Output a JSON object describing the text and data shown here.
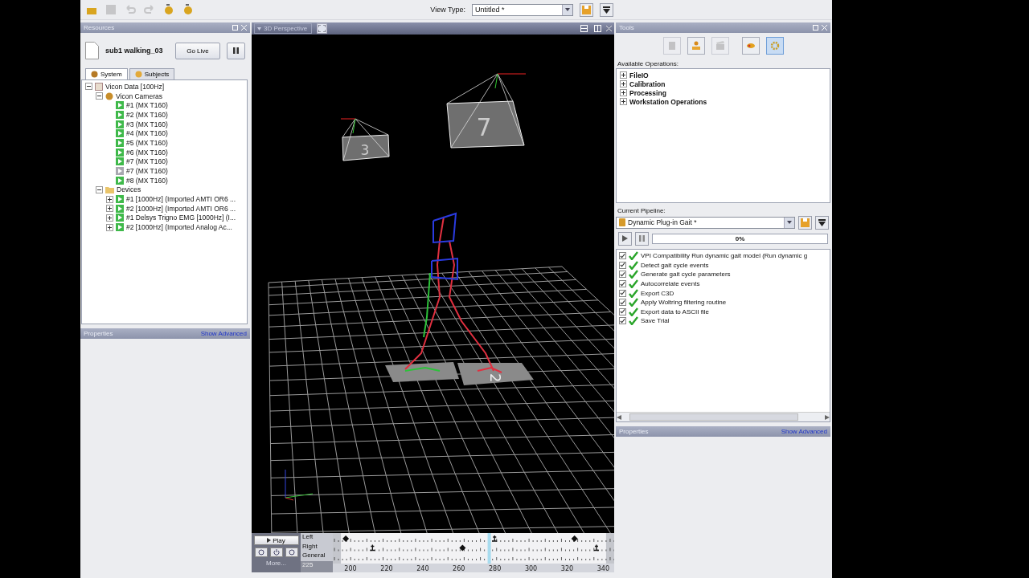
{
  "toolbar": [
    {
      "kind": "open",
      "disabled": false
    },
    {
      "kind": "save",
      "disabled": true
    },
    {
      "kind": "undo",
      "disabled": true
    },
    {
      "kind": "redo",
      "disabled": true
    },
    {
      "kind": "script",
      "disabled": false
    },
    {
      "kind": "script",
      "disabled": false
    }
  ],
  "view_type": {
    "label": "View Type:",
    "value": "Untitled *"
  },
  "resources": {
    "title": "Resources",
    "trial": "sub1 walking_03",
    "go_live": "Go Live",
    "tabs": [
      {
        "label": "System",
        "selected": true
      },
      {
        "label": "Subjects",
        "selected": false
      }
    ],
    "tree": [
      {
        "label": "Vicon Data [100Hz]",
        "kind": "data",
        "expanded": true,
        "children": [
          {
            "label": "Vicon Cameras",
            "kind": "cameras",
            "expanded": true,
            "children": [
              {
                "label": "#1 (MX T160)",
                "kind": "device",
                "active": true
              },
              {
                "label": "#2 (MX T160)",
                "kind": "device",
                "active": true
              },
              {
                "label": "#3 (MX T160)",
                "kind": "device",
                "active": true
              },
              {
                "label": "#4 (MX T160)",
                "kind": "device",
                "active": true
              },
              {
                "label": "#5 (MX T160)",
                "kind": "device",
                "active": true
              },
              {
                "label": "#6 (MX T160)",
                "kind": "device",
                "active": true
              },
              {
                "label": "#7 (MX T160)",
                "kind": "device",
                "active": true
              },
              {
                "label": "#7 (MX T160)",
                "kind": "device",
                "active": false
              },
              {
                "label": "#8 (MX T160)",
                "kind": "device",
                "active": true
              }
            ]
          },
          {
            "label": "Devices",
            "kind": "folder",
            "expanded": true,
            "children": [
              {
                "label": "#1 [1000Hz] (Imported AMTI OR6 ...",
                "kind": "device",
                "active": true,
                "expanded": false
              },
              {
                "label": "#2 [1000Hz] (Imported AMTI OR6 ...",
                "kind": "device",
                "active": true,
                "expanded": false
              },
              {
                "label": "#1 Delsys Trigno EMG [1000Hz] (I...",
                "kind": "device",
                "active": true,
                "expanded": false
              },
              {
                "label": "#2 [1000Hz] (Imported Analog Ac...",
                "kind": "device",
                "active": true,
                "expanded": false
              }
            ]
          }
        ]
      }
    ],
    "properties": {
      "title": "Properties",
      "link": "Show Advanced"
    }
  },
  "viewport": {
    "title": "3D Perspective",
    "cameras": [
      {
        "label": "3"
      },
      {
        "label": "7"
      }
    ],
    "plates": [
      {
        "label": "2"
      }
    ]
  },
  "timeline": {
    "play": "Play",
    "more": "More...",
    "start": "225",
    "tracks": [
      {
        "label": "Left",
        "events": [
          {
            "kind": "strike",
            "level": 0.046
          },
          {
            "kind": "off",
            "level": 0.575
          },
          {
            "kind": "strike",
            "level": 0.859
          }
        ]
      },
      {
        "label": "Right",
        "events": [
          {
            "kind": "off",
            "level": 0.141
          },
          {
            "kind": "strike",
            "level": 0.461
          },
          {
            "kind": "off",
            "level": 0.937
          }
        ]
      },
      {
        "label": "General"
      }
    ],
    "ticks": [
      "200",
      "220",
      "240",
      "260",
      "280",
      "300",
      "320",
      "340"
    ],
    "cursor": {
      "level": 0.556
    }
  },
  "tools": {
    "title": "Tools",
    "buttons": [
      {
        "kind": "subject",
        "disabled": true,
        "selected": false
      },
      {
        "kind": "person",
        "disabled": false,
        "selected": false
      },
      {
        "kind": "clapper",
        "disabled": true,
        "selected": false
      },
      {
        "kind": "capture",
        "disabled": false,
        "selected": false
      },
      {
        "kind": "gear",
        "disabled": false,
        "selected": true
      }
    ],
    "operations_label": "Available Operations:",
    "operations": [
      {
        "label": "FileIO",
        "expanded": false
      },
      {
        "label": "Calibration",
        "expanded": false
      },
      {
        "label": "Processing",
        "expanded": false
      },
      {
        "label": "Workstation Operations",
        "expanded": false
      }
    ],
    "pipeline_label": "Current Pipeline:",
    "pipeline": "Dynamic Plug-in Gait *",
    "progress": {
      "level": 0,
      "text": "0%"
    },
    "steps": [
      {
        "label": "VPI Compatibility Run dynamic gait model (Run dynamic g",
        "checked": true
      },
      {
        "label": "Detect gait cycle events",
        "checked": true
      },
      {
        "label": "Generate gait cycle parameters",
        "checked": true
      },
      {
        "label": "Autocorrelate events",
        "checked": true
      },
      {
        "label": "Export C3D",
        "checked": true
      },
      {
        "label": "Apply Woltring filtering routine",
        "checked": true
      },
      {
        "label": "Export data to ASCII file",
        "checked": true
      },
      {
        "label": "Save Trial",
        "checked": true
      }
    ],
    "properties": {
      "title": "Properties",
      "link": "Show Advanced"
    }
  }
}
